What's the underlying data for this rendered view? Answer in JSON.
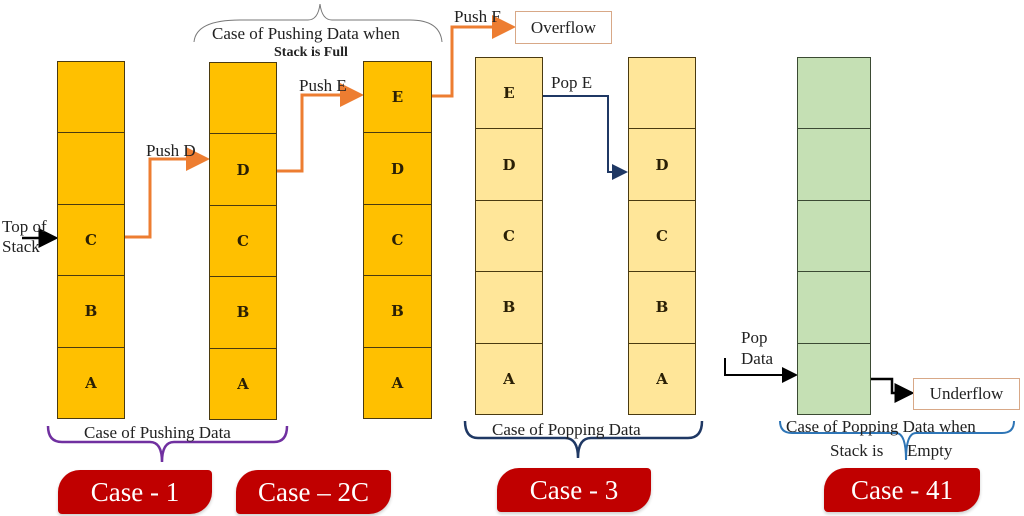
{
  "colors": {
    "stack_full": "#ffc000",
    "stack_light": "#ffe699",
    "stack_empty": "#c5e0b4",
    "push_arrow": "#ed7d31",
    "pop_arrow": "#1f3864",
    "brace_push": "#7030a0",
    "brace_pop": "#1f3864",
    "brace_empty": "#2e75b6",
    "case_badge": "#c00000"
  },
  "stacks": [
    {
      "id": "stack-1",
      "cells": [
        "",
        "",
        "C",
        "B",
        "A"
      ],
      "style": "dark"
    },
    {
      "id": "stack-2",
      "cells": [
        "",
        "D",
        "C",
        "B",
        "A"
      ],
      "style": "dark"
    },
    {
      "id": "stack-3",
      "cells": [
        "E",
        "D",
        "C",
        "B",
        "A"
      ],
      "style": "dark"
    },
    {
      "id": "stack-4",
      "cells": [
        "E",
        "D",
        "C",
        "B",
        "A"
      ],
      "style": "light"
    },
    {
      "id": "stack-5",
      "cells": [
        "",
        "D",
        "C",
        "B",
        "A"
      ],
      "style": "light"
    },
    {
      "id": "stack-6",
      "cells": [
        "",
        "",
        "",
        "",
        ""
      ],
      "style": "green"
    }
  ],
  "labels": {
    "top_of_stack_line1": "Top of",
    "top_of_stack_line2": "Stack",
    "push_d": "Push D",
    "push_e": "Push E",
    "push_f": "Push F",
    "pop_e": "Pop E",
    "pop_data_line1": "Pop",
    "pop_data_line2": "Data",
    "overflow": "Overflow",
    "underflow": "Underflow",
    "full_case_line1": "Case of Pushing Data when",
    "full_case_line2": "Stack is Full",
    "pushing_case": "Case of Pushing Data",
    "popping_case": "Case of Popping Data",
    "empty_case_line1": "Case of Popping Data when",
    "empty_case_line2a": "Stack is",
    "empty_case_line2b": "Empty"
  },
  "cases": [
    {
      "label": "Case - 1"
    },
    {
      "label": "Case – 2C"
    },
    {
      "label": "Case - 3"
    },
    {
      "label": "Case - 41"
    }
  ]
}
